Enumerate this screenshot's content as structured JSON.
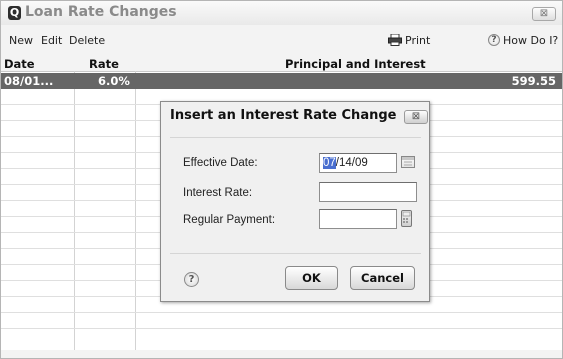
{
  "window": {
    "title": "Loan Rate Changes",
    "logo_letter": "Q",
    "close_glyph": "⊠"
  },
  "menu": {
    "new": "New",
    "edit": "Edit",
    "delete": "Delete",
    "print": "Print",
    "help": "How Do I?"
  },
  "columns": {
    "date": "Date",
    "rate": "Rate",
    "principal_interest": "Principal and Interest"
  },
  "rows": [
    {
      "date": "08/01...",
      "rate": "6.0%",
      "amount": "599.55"
    }
  ],
  "dialog": {
    "title": "Insert an Interest Rate Change",
    "close_glyph": "⊠",
    "effective_date_label": "Effective Date:",
    "effective_date_selected": "07",
    "effective_date_rest": "/14/09",
    "interest_rate_label": "Interest Rate:",
    "interest_rate_value": "",
    "regular_payment_label": "Regular Payment:",
    "regular_payment_value": "",
    "help_glyph": "?",
    "ok_label": "OK",
    "cancel_label": "Cancel"
  },
  "icons": {
    "window_close": "close-icon",
    "printer": "printer-icon",
    "help": "help-icon",
    "calendar": "calendar-icon",
    "calculator": "calculator-icon"
  },
  "colors": {
    "selected_row": "#666666",
    "date_selection": "#4a6fd0",
    "title_gray": "#8a8a8a"
  }
}
